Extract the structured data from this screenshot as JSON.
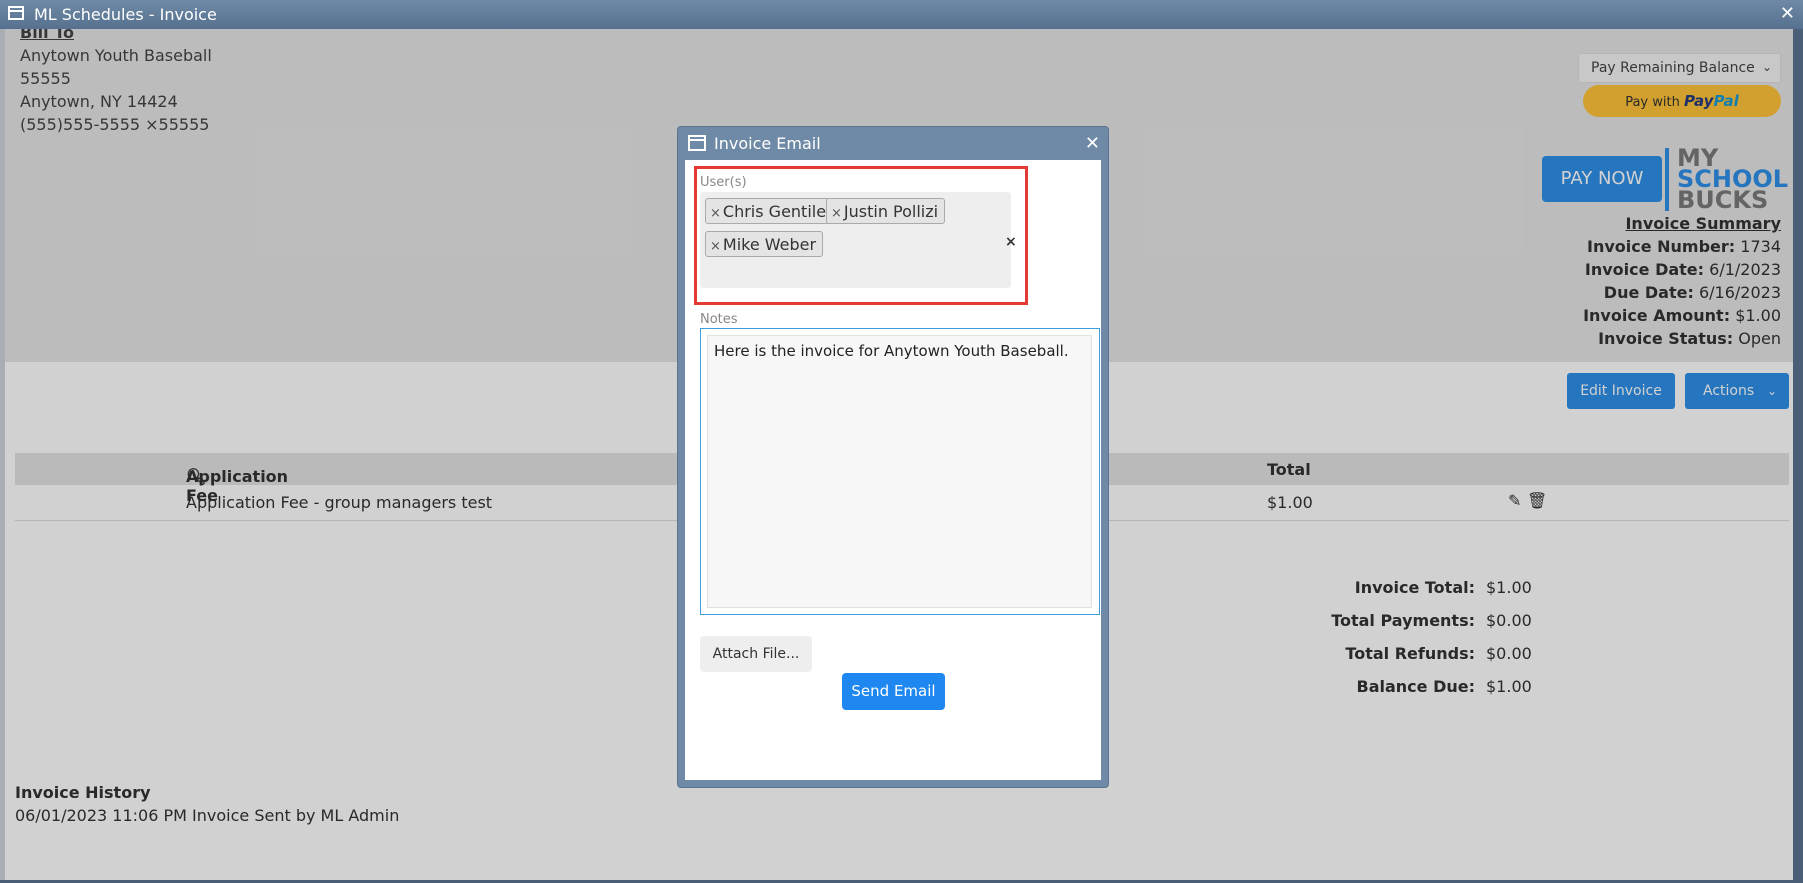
{
  "window": {
    "title": "ML Schedules - Invoice"
  },
  "bill_to": {
    "label": "Bill To",
    "name": "Anytown Youth Baseball",
    "line2": "55555",
    "city": "Anytown, NY 14424",
    "phone": "(555)555-5555 ×55555"
  },
  "payment": {
    "select_value": "Pay Remaining Balance",
    "paypal_prefix": "Pay with",
    "paypal_brand_a": "Pay",
    "paypal_brand_b": "Pal",
    "pay_now": "PAY NOW",
    "logo_line1": "MY",
    "logo_line2": "SCHOOL",
    "logo_line3": "BUCKS"
  },
  "summary": {
    "heading": "Invoice Summary",
    "number_label": "Invoice Number:",
    "number": "1734",
    "date_label": "Invoice Date:",
    "date": "6/1/2023",
    "due_label": "Due Date:",
    "due": "6/16/2023",
    "amount_label": "Invoice Amount:",
    "amount": "$1.00",
    "status_label": "Invoice Status:",
    "status": "Open"
  },
  "toolbar": {
    "edit": "Edit Invoice",
    "actions": "Actions"
  },
  "table": {
    "col_item": "Application Fee",
    "col_total": "Total",
    "rows": [
      {
        "item": "Application Fee - group managers test",
        "total": "$1.00"
      }
    ]
  },
  "totals": {
    "invoice_total_label": "Invoice Total:",
    "invoice_total": "$1.00",
    "payments_label": "Total Payments:",
    "payments": "$0.00",
    "refunds_label": "Total Refunds:",
    "refunds": "$0.00",
    "balance_label": "Balance Due:",
    "balance": "$1.00"
  },
  "history": {
    "heading": "Invoice History",
    "entries": [
      "06/01/2023 11:06 PM Invoice Sent by ML Admin"
    ]
  },
  "modal": {
    "title": "Invoice Email",
    "users_label": "User(s)",
    "users": [
      "Chris Gentile",
      "Justin Pollizi",
      "Mike Weber"
    ],
    "notes_label": "Notes",
    "notes_value": "Here is the invoice for Anytown Youth Baseball.",
    "attach": "Attach File...",
    "send": "Send Email"
  },
  "colors": {
    "accent": "#2f8fe9",
    "titlebar": "#6f8aa6",
    "highlight": "#e53935"
  }
}
